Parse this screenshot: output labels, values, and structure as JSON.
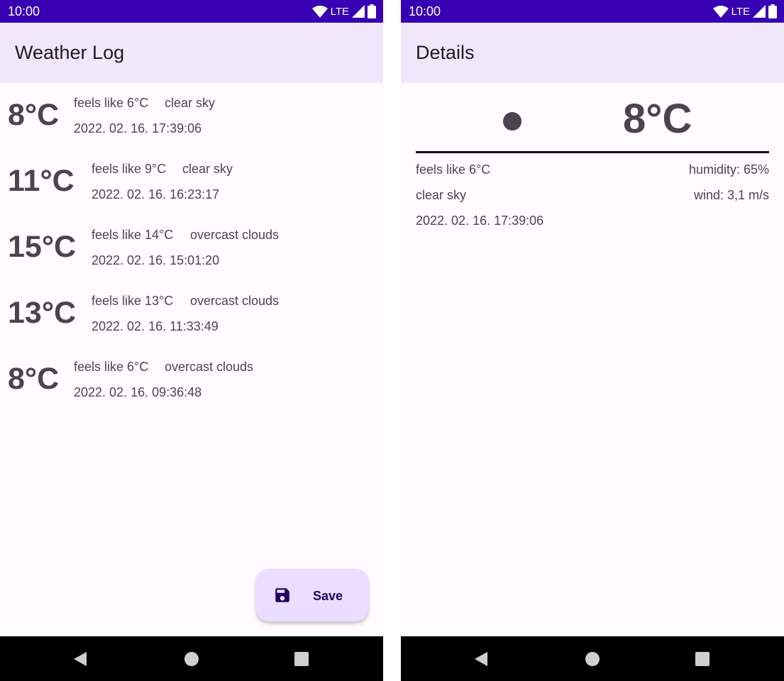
{
  "status_bar": {
    "time": "10:00",
    "network": "LTE"
  },
  "log_screen": {
    "title": "Weather Log",
    "entries": [
      {
        "temp": "8°C",
        "feels_like": "feels like 6°C",
        "description": "clear sky",
        "datetime": "2022. 02. 16. 17:39:06"
      },
      {
        "temp": "11°C",
        "feels_like": "feels like 9°C",
        "description": "clear sky",
        "datetime": "2022. 02. 16. 16:23:17"
      },
      {
        "temp": "15°C",
        "feels_like": "feels like 14°C",
        "description": "overcast clouds",
        "datetime": "2022. 02. 16. 15:01:20"
      },
      {
        "temp": "13°C",
        "feels_like": "feels like 13°C",
        "description": "overcast clouds",
        "datetime": "2022. 02. 16. 11:33:49"
      },
      {
        "temp": "8°C",
        "feels_like": "feels like 6°C",
        "description": "overcast clouds",
        "datetime": "2022. 02. 16. 09:36:48"
      }
    ],
    "fab": {
      "label": "Save",
      "icon": "save-icon"
    }
  },
  "details_screen": {
    "title": "Details",
    "weather_icon": "weather-dot-icon",
    "temp": "8°C",
    "feels_like": "feels like 6°C",
    "humidity": "humidity: 65%",
    "description": "clear sky",
    "wind": "wind: 3,1 m/s",
    "datetime": "2022. 02. 16. 17:39:06"
  },
  "colors": {
    "status_bar": "#3700b3",
    "app_bar": "#f0e7fb",
    "background": "#fffbfe",
    "fab": "#eaddff",
    "text": "#49454f"
  }
}
